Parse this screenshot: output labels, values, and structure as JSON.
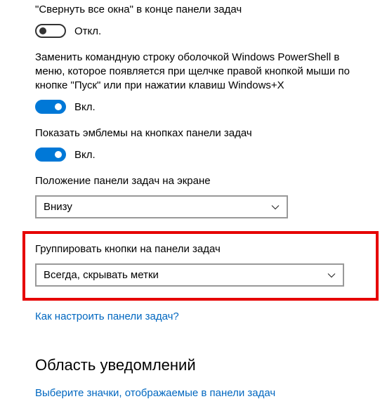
{
  "settings": {
    "peek": {
      "label": "\"Свернуть все окна\" в конце панели задач",
      "state": "Откл."
    },
    "powershell": {
      "label": "Заменить командную строку оболочкой Windows PowerShell в меню, которое появляется при щелчке правой кнопкой мыши по кнопке \"Пуск\" или при нажатии клавиш Windows+X",
      "state": "Вкл."
    },
    "badges": {
      "label": "Показать эмблемы на кнопках панели задач",
      "state": "Вкл."
    },
    "position": {
      "label": "Положение панели задач на экране",
      "value": "Внизу"
    },
    "grouping": {
      "label": "Группировать кнопки на панели задач",
      "value": "Всегда, скрывать метки"
    }
  },
  "links": {
    "customize": "Как настроить панели задач?",
    "selectIcons": "Выберите значки, отображаемые в панели задач"
  },
  "headings": {
    "notifications": "Область уведомлений"
  }
}
